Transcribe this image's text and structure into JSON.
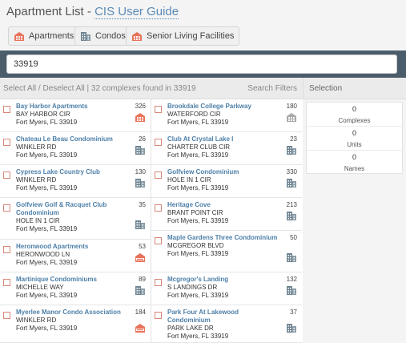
{
  "header": {
    "title": "Apartment List",
    "separator": "-",
    "guide_link": "CIS User Guide"
  },
  "filters": [
    {
      "label": "Apartments",
      "icon": "apartment-icon"
    },
    {
      "label": "Condos",
      "icon": "condo-building-icon"
    },
    {
      "label": "Senior Living Facilities",
      "icon": "senior-living-icon"
    }
  ],
  "search": {
    "value": "33919"
  },
  "status": {
    "select_all": "Select All",
    "slash": "/",
    "deselect_all": "Deselect All",
    "divider": "|",
    "summary": "32 complexes found in 33919",
    "search_filters": "Search Filters"
  },
  "colors": {
    "apartment_icon": "#e8735a",
    "condo_icon": "#6f8491",
    "senior_icon": "#a9a9a9",
    "link": "#4d7fa8",
    "search_bar": "#4b5d6b"
  },
  "results": {
    "left": [
      {
        "name": "Bay Harbor Apartments",
        "street": "BAY HARBOR CIR",
        "city": "Fort Myers, FL 33919",
        "count": "326",
        "type": "apartment"
      },
      {
        "name": "Chateau Le Beau Condominium",
        "street": "WINKLER RD",
        "city": "Fort Myers, FL 33919",
        "count": "26",
        "type": "condo"
      },
      {
        "name": "Cypress Lake Country Club",
        "street": "WINKLER RD",
        "city": "Fort Myers, FL 33919",
        "count": "130",
        "type": "condo"
      },
      {
        "name": "Golfview Golf & Racquet Club Condominium",
        "street": "HOLE IN 1 CIR",
        "city": "Fort Myers, FL 33919",
        "count": "35",
        "type": "condo"
      },
      {
        "name": "Heronwood Apartments",
        "street": "HERONWOOD LN",
        "city": "Fort Myers, FL 33919",
        "count": "53",
        "type": "apartment-new"
      },
      {
        "name": "Martinique Condominiums",
        "street": "MICHELLE WAY",
        "city": "Fort Myers, FL 33919",
        "count": "89",
        "type": "condo"
      },
      {
        "name": "Myerlee Manor Condo Association",
        "street": "WINKLER RD",
        "city": "Fort Myers, FL 33919",
        "count": "184",
        "type": "apartment-new"
      }
    ],
    "right": [
      {
        "name": "Brookdale College Parkway",
        "street": "WATERFORD CIR",
        "city": "Fort Myers, FL 33919",
        "count": "180",
        "type": "senior"
      },
      {
        "name": "Club At Crystal Lake I",
        "street": "CHARTER CLUB CIR",
        "city": "Fort Myers, FL 33919",
        "count": "23",
        "type": "condo"
      },
      {
        "name": "Golfview Condominium",
        "street": "HOLE IN 1 CIR",
        "city": "Fort Myers, FL 33919",
        "count": "330",
        "type": "condo"
      },
      {
        "name": "Heritage Cove",
        "street": "BRANT POINT CIR",
        "city": "Fort Myers, FL 33919",
        "count": "213",
        "type": "condo"
      },
      {
        "name": "Maple Gardens Three Condominium",
        "street": "MCGREGOR BLVD",
        "city": "Fort Myers, FL 33919",
        "count": "50",
        "type": "condo"
      },
      {
        "name": "Mcgregor's Landing",
        "street": "S LANDINGS DR",
        "city": "Fort Myers, FL 33919",
        "count": "132",
        "type": "condo"
      },
      {
        "name": "Park Four At Lakewood Condominium",
        "street": "PARK LAKE DR",
        "city": "Fort Myers, FL 33919",
        "count": "37",
        "type": "condo"
      }
    ]
  },
  "selection": {
    "title": "Selection",
    "stats": [
      {
        "value": "0",
        "label": "Complexes"
      },
      {
        "value": "0",
        "label": "Units"
      },
      {
        "value": "0",
        "label": "Names"
      }
    ]
  }
}
